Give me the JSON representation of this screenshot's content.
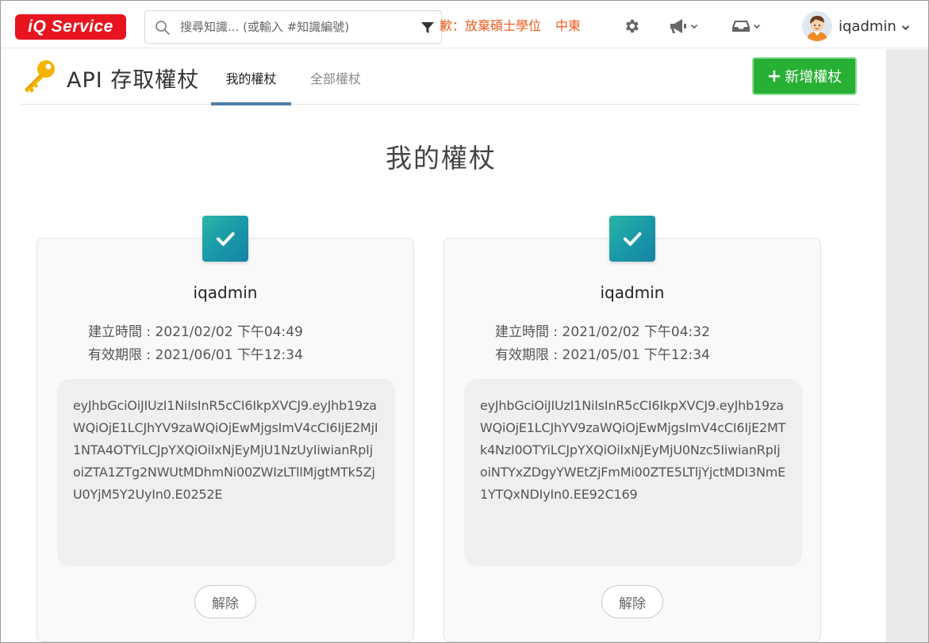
{
  "navbar": {
    "logo_text": "iQ Service",
    "search_placeholder": "搜尋知識... (或輸入 #知識編號)",
    "marquee_items": [
      "歉：放棄碩士學位",
      "中東"
    ],
    "username": "iqadmin"
  },
  "page": {
    "title": "API 存取權杖",
    "tabs": [
      {
        "label": "我的權杖",
        "active": true
      },
      {
        "label": "全部權杖",
        "active": false
      }
    ],
    "add_button_label": "新增權杖",
    "section_title": "我的權杖"
  },
  "tokens": [
    {
      "user": "iqadmin",
      "created": "建立時間 : 2021/02/02 下午04:49",
      "expires": "有效期限 : 2021/06/01 下午12:34",
      "token": "eyJhbGciOiJIUzI1NiIsInR5cCI6IkpXVCJ9.eyJhb19zaWQiOjE1LCJhYV9zaWQiOjEwMjgsImV4cCI6IjE2MjI1NTA4OTYiLCJpYXQiOiIxNjEyMjU1NzUyIiwianRpIjoiZTA1ZTg2NWUtMDhmNi00ZWIzLTllMjgtMTk5ZjU0YjM5Y2UyIn0.E0252E",
      "revoke_label": "解除"
    },
    {
      "user": "iqadmin",
      "created": "建立時間 : 2021/02/02 下午04:32",
      "expires": "有效期限 : 2021/05/01 下午12:34",
      "token": "eyJhbGciOiJIUzI1NiIsInR5cCI6IkpXVCJ9.eyJhb19zaWQiOjE1LCJhYV9zaWQiOjEwMjgsImV4cCI6IjE2MTk4NzI0OTYiLCJpYXQiOiIxNjEyMjU0Nzc5IiwianRpIjoiNTYxZDgyYWEtZjFmMi00ZTE5LTljYjctMDI3NmE1YTQxNDIyIn0.EE92C169",
      "revoke_label": "解除"
    }
  ],
  "colors": {
    "logo_red": "#e8141f",
    "accent_orange": "#f05a1c",
    "add_green": "#28b035",
    "tab_underline": "#4f7fa5",
    "check_teal": "#1a9aa8"
  },
  "icons": {
    "search": "search-icon",
    "filter": "filter-icon",
    "settings": "gear-icon",
    "announce": "megaphone-icon",
    "inbox": "inbox-icon",
    "title": "key-icon",
    "status": "check-icon"
  }
}
